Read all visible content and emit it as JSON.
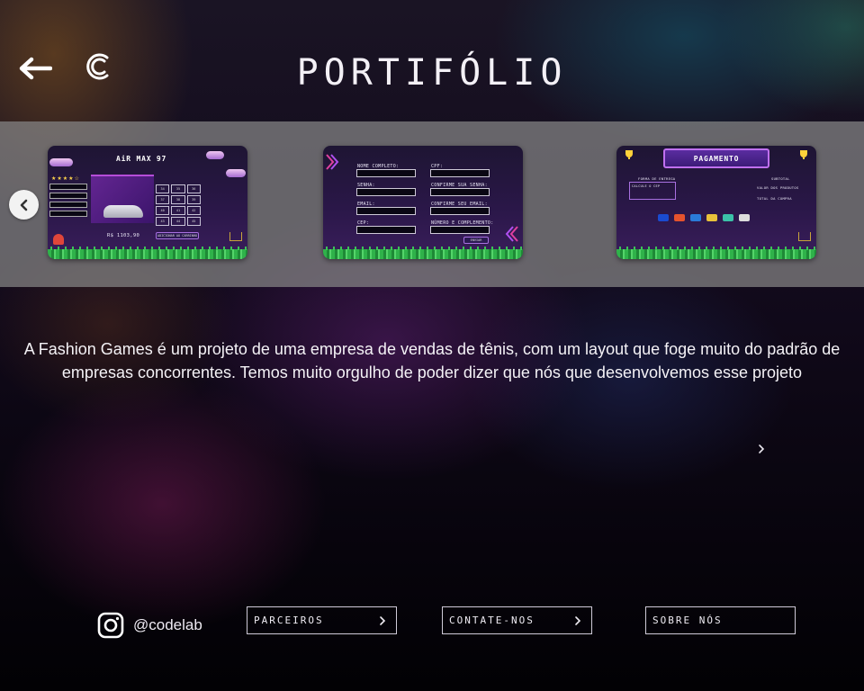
{
  "header": {
    "title": "PORTIFÓLIO",
    "back_icon": "arrow-left-icon",
    "logo_icon": "codelab-logo-icon"
  },
  "carousel": {
    "prev_icon": "chevron-left-icon",
    "slides": [
      {
        "name": "product-page",
        "title": "AiR MAX 97",
        "price": "R$ 1103,90",
        "button": "ADICIONAR AO CARRINHO",
        "sizes": [
          "34",
          "35",
          "36",
          "37",
          "38",
          "39",
          "40",
          "41",
          "42",
          "43",
          "44",
          "45"
        ]
      },
      {
        "name": "signup-form",
        "fields": [
          "NOME COMPLETO:",
          "CPF:",
          "SENHA:",
          "CONFIRME SUA SENHA:",
          "EMAIL:",
          "CONFIRME SEU EMAIL:",
          "CEP:",
          "NÚMERO E COMPLEMENTO:"
        ],
        "button": "ENVIAR"
      },
      {
        "name": "payment-page",
        "title": "PAGAMENTO",
        "labels": [
          "FORMA DE ENTREGA",
          "CALCULE O CEP",
          "SUBTOTAL",
          "VALOR DOS PRODUTOS",
          "TOTAL DA COMPRA"
        ],
        "payment_methods": [
          "VISA",
          "mastercard",
          "amex",
          "elo",
          "pix",
          "boleto"
        ]
      }
    ]
  },
  "description": "A Fashion Games é um projeto de uma empresa de vendas de tênis, com um layout que foge muito do padrão de empresas concorrentes. Temos muito orgulho de poder dizer que nós que desenvolvemos esse projeto",
  "next_icon": "chevron-right-icon",
  "footer": {
    "instagram_handle": "@codelab",
    "instagram_icon": "instagram-icon",
    "buttons": [
      {
        "label": "PARCEIROS",
        "icon": "chevron-right-icon"
      },
      {
        "label": "CONTATE-NOS",
        "icon": "chevron-right-icon"
      },
      {
        "label": "SOBRE NÓS"
      }
    ]
  },
  "colors": {
    "carousel_band": "#878787",
    "text": "#ffffff",
    "accent_purple": "#a870e0",
    "grass_green": "#2fb24a"
  }
}
